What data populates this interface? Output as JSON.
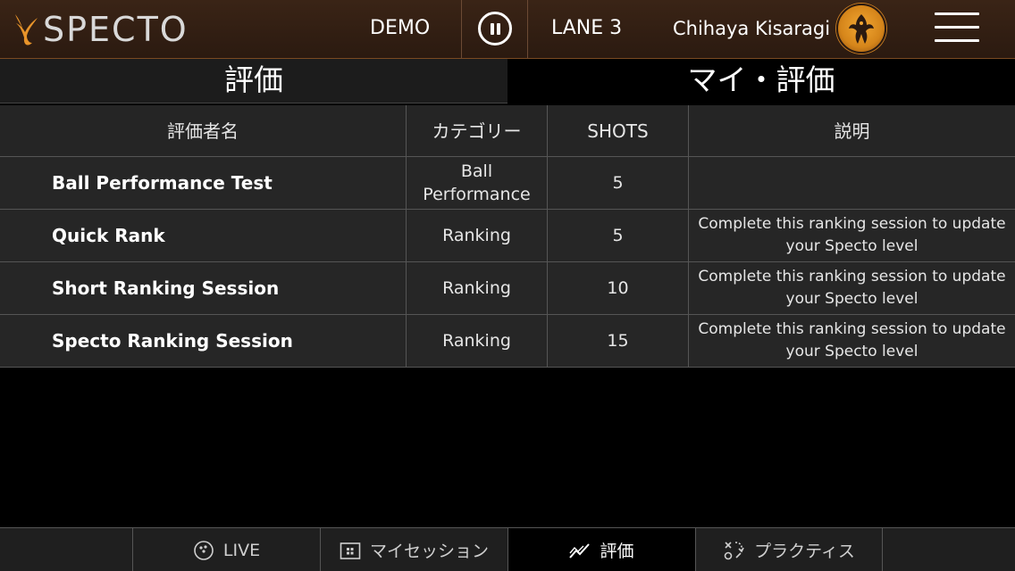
{
  "header": {
    "logo_text": "SPECTO",
    "mode_label": "DEMO",
    "pause_icon": "pause-icon",
    "lane_label": "LANE 3",
    "user_name": "Chihaya Kisaragi",
    "menu_icon": "hamburger-menu-icon",
    "accent_color": "#e8942a"
  },
  "tabs": [
    {
      "label": "評価",
      "active": false
    },
    {
      "label": "マイ・評価",
      "active": true
    }
  ],
  "table": {
    "columns": [
      "評価者名",
      "カテゴリー",
      "SHOTS",
      "説明"
    ],
    "rows": [
      {
        "name": "Ball Performance Test",
        "category": "Ball Performance",
        "shots": "5",
        "description": ""
      },
      {
        "name": "Quick Rank",
        "category": "Ranking",
        "shots": "5",
        "description": "Complete this ranking session to update your Specto level"
      },
      {
        "name": "Short Ranking Session",
        "category": "Ranking",
        "shots": "10",
        "description": "Complete this ranking session to update your Specto level"
      },
      {
        "name": "Specto Ranking Session",
        "category": "Ranking",
        "shots": "15",
        "description": "Complete this ranking session to update your Specto level"
      }
    ]
  },
  "bottom_nav": [
    {
      "label": "LIVE",
      "icon": "bowling-ball-icon",
      "active": false
    },
    {
      "label": "マイセッション",
      "icon": "sessions-folder-icon",
      "active": false
    },
    {
      "label": "評価",
      "icon": "chart-line-icon",
      "active": true
    },
    {
      "label": "プラクティス",
      "icon": "practice-play-icon",
      "active": false
    }
  ]
}
